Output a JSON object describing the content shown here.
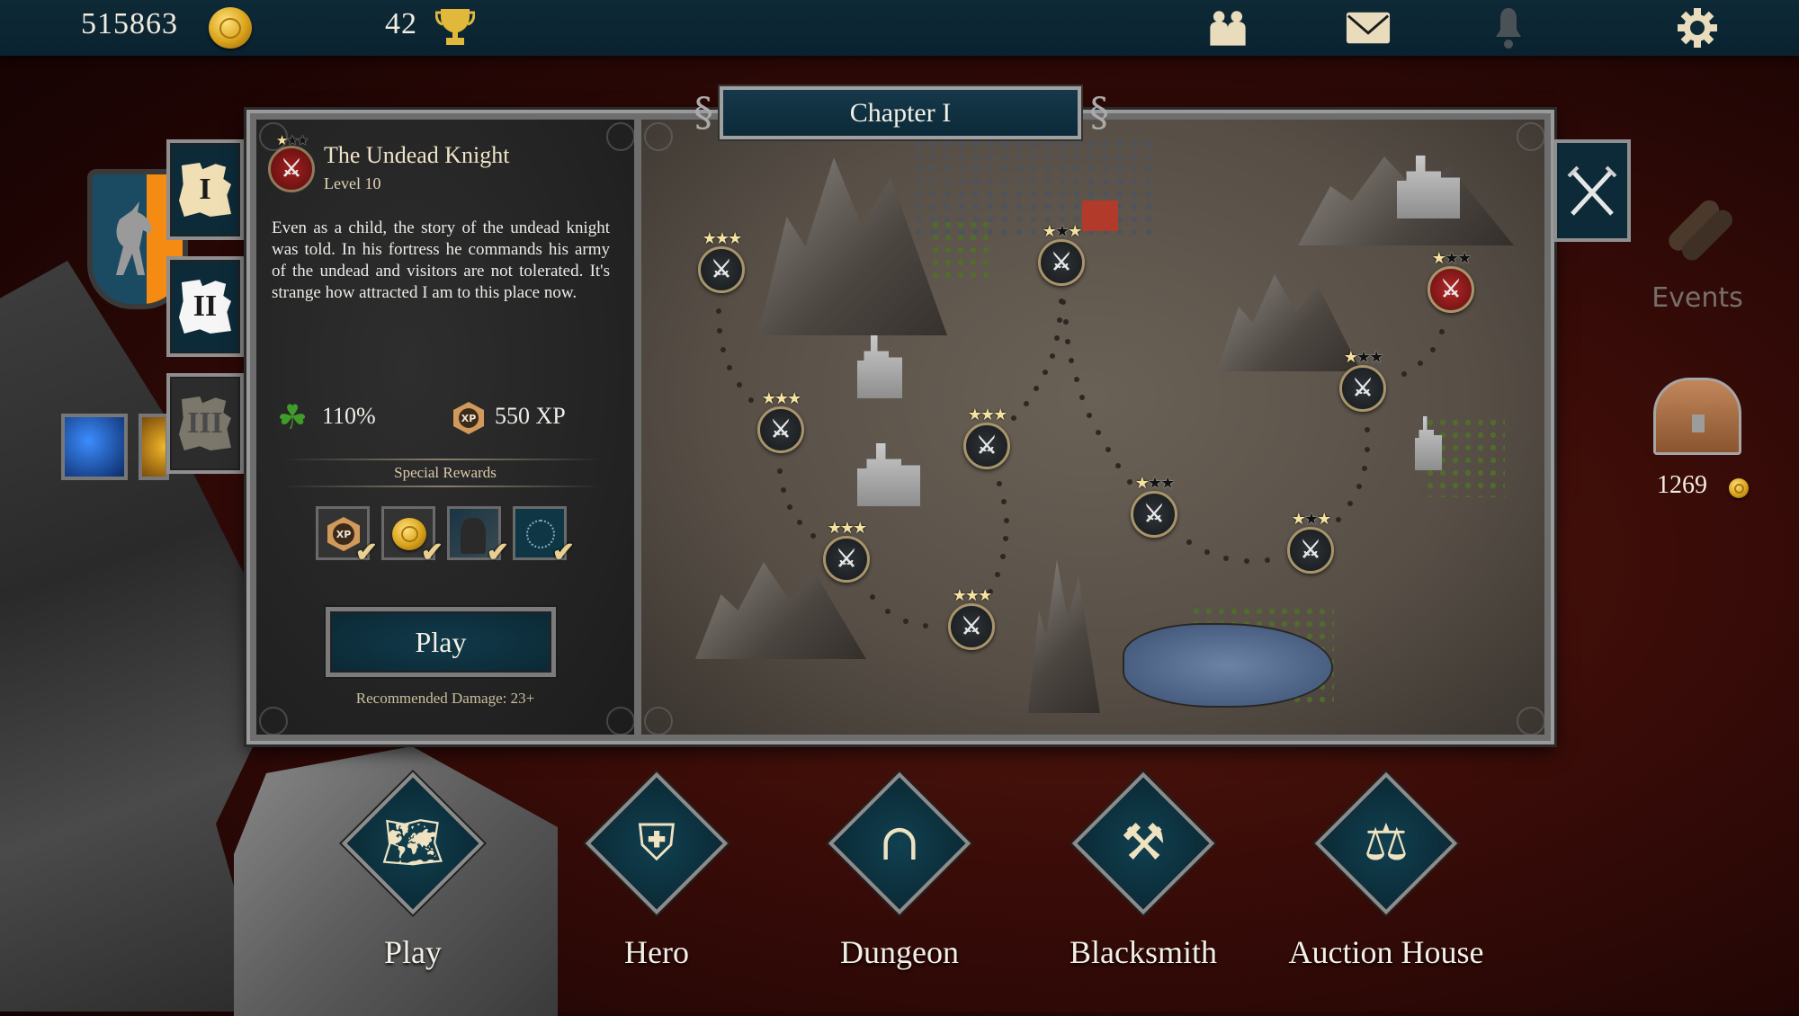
{
  "topbar": {
    "gold": "515863",
    "trophies": "42",
    "icons": [
      "friends-icon",
      "mail-icon",
      "notifications-bell-icon",
      "settings-gear-icon"
    ]
  },
  "chapter_tabs": [
    {
      "label": "I",
      "state": "active"
    },
    {
      "label": "II",
      "state": "unlocked"
    },
    {
      "label": "III",
      "state": "locked"
    }
  ],
  "chapter": {
    "title": "Chapter I"
  },
  "level_panel": {
    "name": "The Undead Knight",
    "level": "Level 10",
    "stars_earned": 1,
    "stars_total": 3,
    "description": "Even as a child, the story of the undead knight was told. In his fortress he commands his army of the undead and visitors are not tolerated. It's strange how attracted I am to this place now.",
    "luck": "110%",
    "xp_badge": "XP",
    "xp": "550 XP",
    "special_rewards_label": "Special Rewards",
    "rewards": [
      {
        "type": "xp",
        "badge": "XP",
        "claimed": true
      },
      {
        "type": "gold",
        "claimed": true
      },
      {
        "type": "character",
        "claimed": true
      },
      {
        "type": "rune",
        "claimed": true
      }
    ],
    "play_label": "Play",
    "recommended": "Recommended Damage: 23+"
  },
  "map_nodes": [
    {
      "stars": 3,
      "selected": false
    },
    {
      "stars": 3,
      "selected": false
    },
    {
      "stars": 3,
      "selected": false
    },
    {
      "stars": 3,
      "selected": false
    },
    {
      "stars": 3,
      "selected": false
    },
    {
      "stars": 2,
      "selected": false
    },
    {
      "stars": 1,
      "selected": false
    },
    {
      "stars": 2,
      "selected": false
    },
    {
      "stars": 1,
      "selected": false
    },
    {
      "stars": 1,
      "selected": true
    }
  ],
  "right": {
    "events_label": "Events",
    "chest_count": "1269"
  },
  "bottom_nav": [
    {
      "label": "Play",
      "icon": "treasure-map-icon",
      "glyph": "🗺"
    },
    {
      "label": "Hero",
      "icon": "armor-icon",
      "glyph": "⛨"
    },
    {
      "label": "Dungeon",
      "icon": "archway-icon",
      "glyph": "∩"
    },
    {
      "label": "Blacksmith",
      "icon": "anvil-icon",
      "glyph": "⚒"
    },
    {
      "label": "Auction House",
      "icon": "gavel-icon",
      "glyph": "⚖"
    }
  ],
  "colors": {
    "topbar": "#0e2a36",
    "panel_teal": "#0d2a38",
    "star_gold": "#f4e2a0",
    "node_red": "#b52626",
    "text_cream": "#efe3c8"
  }
}
